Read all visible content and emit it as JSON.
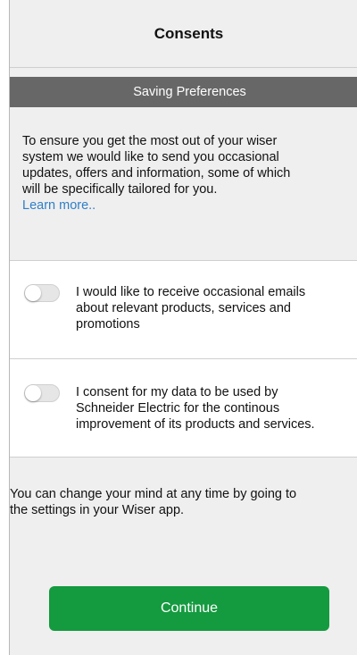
{
  "header": {
    "title": "Consents"
  },
  "section": {
    "label": "Saving Preferences"
  },
  "intro": {
    "text_lines": [
      "To ensure you get the most out of your wiser",
      "system we would like to send you occasional",
      "updates, offers and information, some of which",
      "will be specifically tailored for you."
    ],
    "link_label": "Learn more.."
  },
  "options": [
    {
      "enabled": false,
      "lines": [
        "I would like to receive occasional emails",
        "about relevant products, services and",
        "promotions"
      ]
    },
    {
      "enabled": false,
      "lines": [
        "I consent for my data to be used by",
        "Schneider Electric for the continous",
        "improvement of its products and services."
      ]
    }
  ],
  "note": {
    "lines": [
      "You can change your mind at any time by going to",
      "the settings in your Wiser app."
    ]
  },
  "continue_button": {
    "label": "Continue"
  },
  "colors": {
    "section_bar": "#676767",
    "link": "#2f7fc7",
    "primary_button": "#149a3f"
  }
}
